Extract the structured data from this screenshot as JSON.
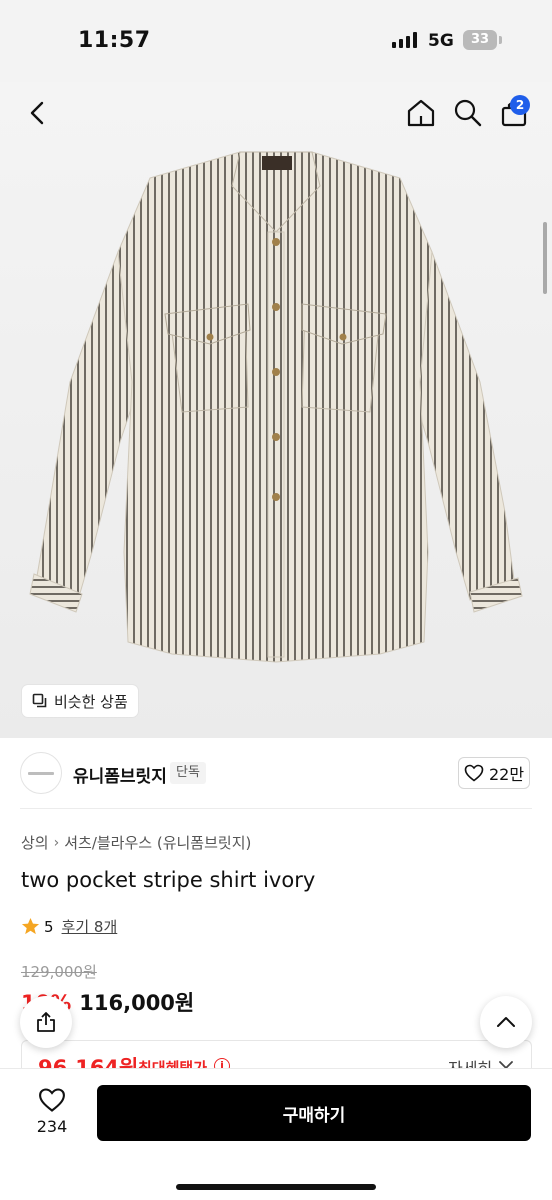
{
  "status_bar": {
    "time": "11:57",
    "network": "5G",
    "battery": "33"
  },
  "nav": {
    "cart_count": "2"
  },
  "hero": {
    "similar_label": "비슷한 상품"
  },
  "brand": {
    "name": "유니폼브릿지",
    "tag": "단독",
    "likes": "22만"
  },
  "product": {
    "breadcrumb": [
      "상의",
      "셔츠/블라우스 (유니폼브릿지)"
    ],
    "title": "two pocket stripe shirt ivory",
    "rating": "5",
    "reviews": "후기 8개",
    "original_price": "129,000원",
    "discount": "10%",
    "sale_price": "116,000원"
  },
  "benefit": {
    "price": "96,164원",
    "label": "최대혜택가",
    "more": "자세히"
  },
  "bottom": {
    "wish_count": "234",
    "buy_label": "구매하기"
  },
  "colors": {
    "accent_red": "#ee2323",
    "badge_blue": "#1f5eea",
    "star": "#f5a623"
  },
  "icons": [
    "back-icon",
    "home-icon",
    "search-icon",
    "bag-icon",
    "copy-icon",
    "heart-icon",
    "star-icon",
    "info-icon",
    "chevron-down-icon",
    "share-icon",
    "chevron-up-icon"
  ]
}
